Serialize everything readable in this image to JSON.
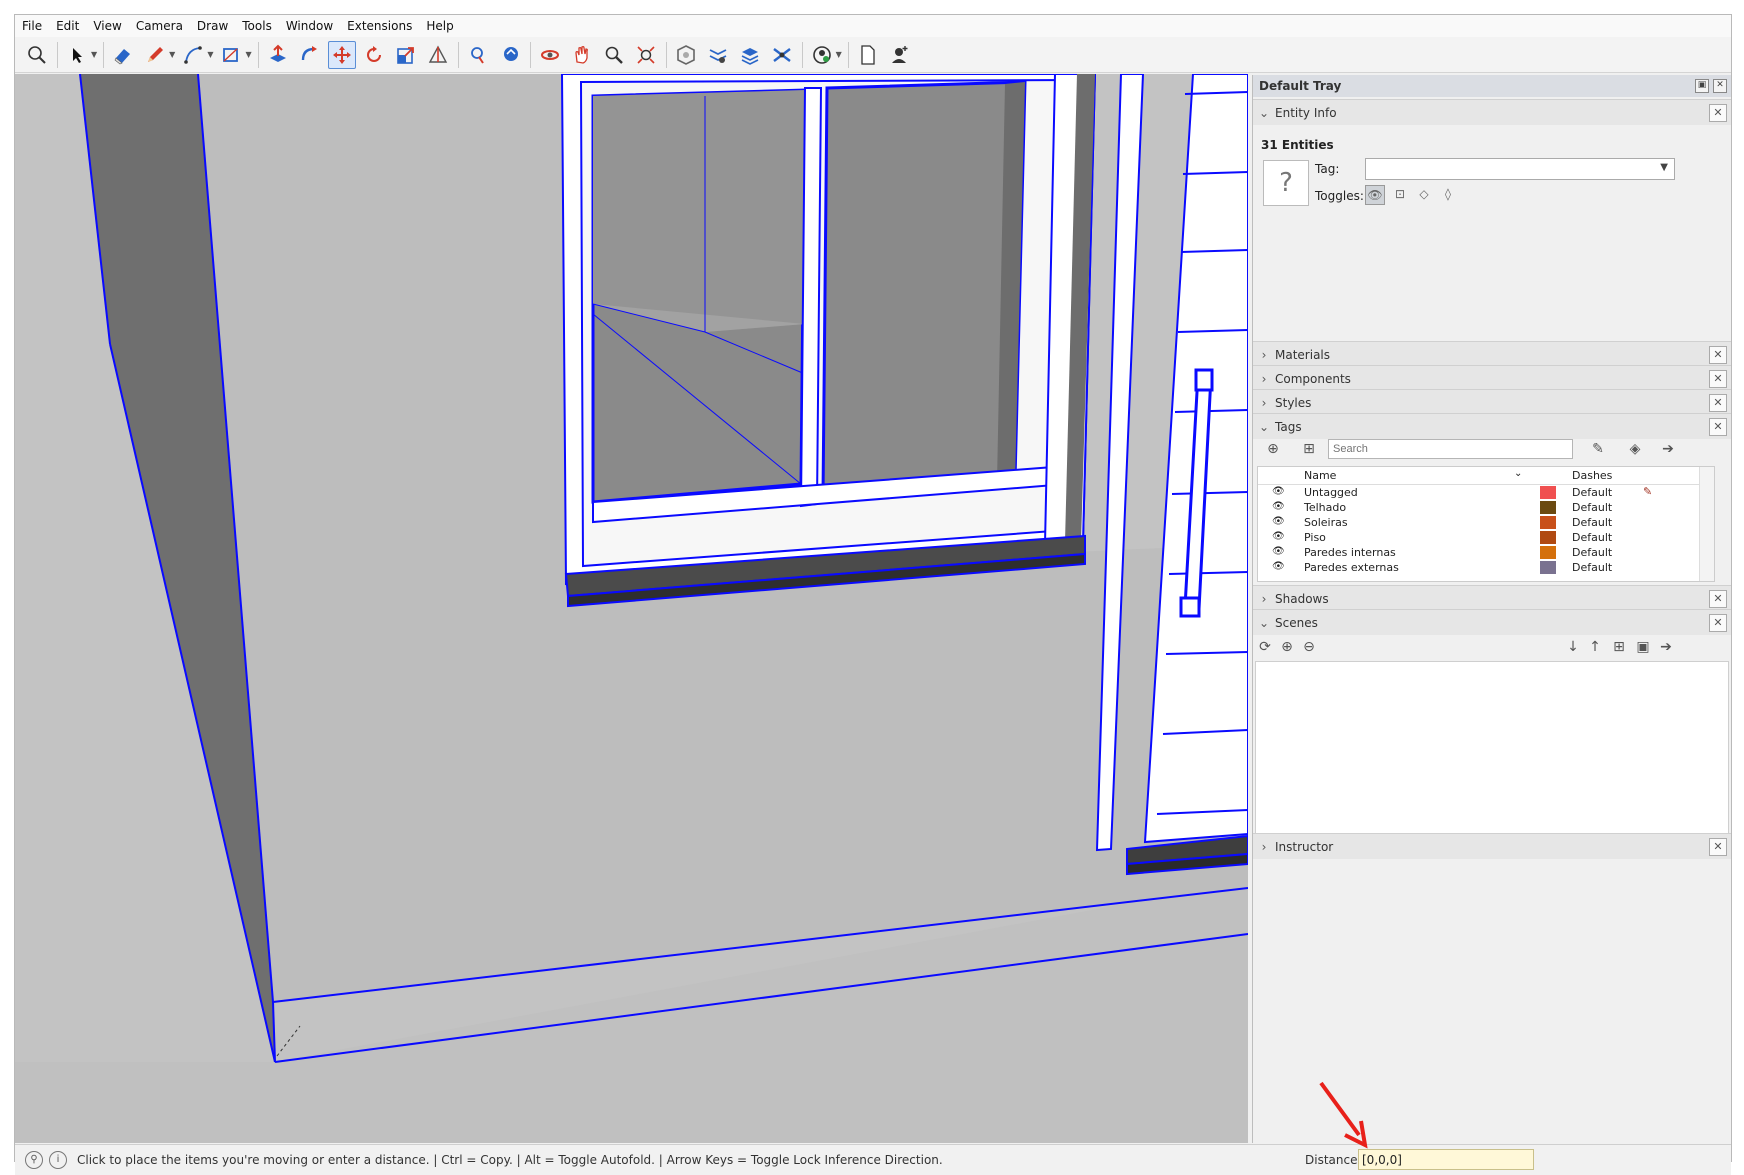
{
  "menu": [
    "File",
    "Edit",
    "View",
    "Camera",
    "Draw",
    "Tools",
    "Window",
    "Extensions",
    "Help"
  ],
  "toolbar": {
    "tools": [
      "zoom-extents-icon",
      "select-icon",
      "eraser-icon",
      "pencil-icon",
      "arc-icon",
      "rectangle-icon",
      "push-pull-icon",
      "follow-me-icon",
      "move-icon",
      "rotate-icon",
      "scale-icon",
      "section-plane-icon",
      "position-camera-icon",
      "walk-icon",
      "orbit-icon",
      "pan-icon",
      "zoom-icon",
      "zoom-window-icon",
      "outer-shell-icon",
      "intersect-icon",
      "union-icon",
      "solid-tools-icon",
      "account-icon",
      "new-file-icon",
      "user-icon"
    ],
    "active_tool": "move-icon"
  },
  "tray": {
    "title": "Default Tray",
    "entity_info": {
      "header": "Entity Info",
      "count": "31 Entities",
      "tag_label": "Tag:",
      "tag_value": "",
      "toggles_label": "Toggles:"
    },
    "panels": {
      "materials": "Materials",
      "components": "Components",
      "styles": "Styles",
      "tags": "Tags",
      "shadows": "Shadows",
      "scenes": "Scenes",
      "instructor": "Instructor"
    },
    "tags": {
      "search_placeholder": "Search",
      "col_name": "Name",
      "col_dashes": "Dashes",
      "rows": [
        {
          "name": "Untagged",
          "color": "#f05050",
          "dashes": "Default"
        },
        {
          "name": "Telhado",
          "color": "#6b4a10",
          "dashes": "Default"
        },
        {
          "name": "Soleiras",
          "color": "#c8501a",
          "dashes": "Default"
        },
        {
          "name": "Piso",
          "color": "#b04a12",
          "dashes": "Default"
        },
        {
          "name": "Paredes internas",
          "color": "#d4700c",
          "dashes": "Default"
        },
        {
          "name": "Paredes externas",
          "color": "#7a7290",
          "dashes": "Default"
        }
      ]
    }
  },
  "status": {
    "message": "Click to place the items you're moving or enter a distance. | Ctrl = Copy. | Alt = Toggle Autofold. | Arrow Keys = Toggle Lock Inference Direction.",
    "vcb_label": "Distance",
    "vcb_value": "[0,0,0]"
  },
  "colors": {
    "selection": "#0000ff",
    "wall": "#c3c3c3",
    "wall_dark": "#6e6e6e",
    "annotation_arrow": "#e8201a"
  }
}
